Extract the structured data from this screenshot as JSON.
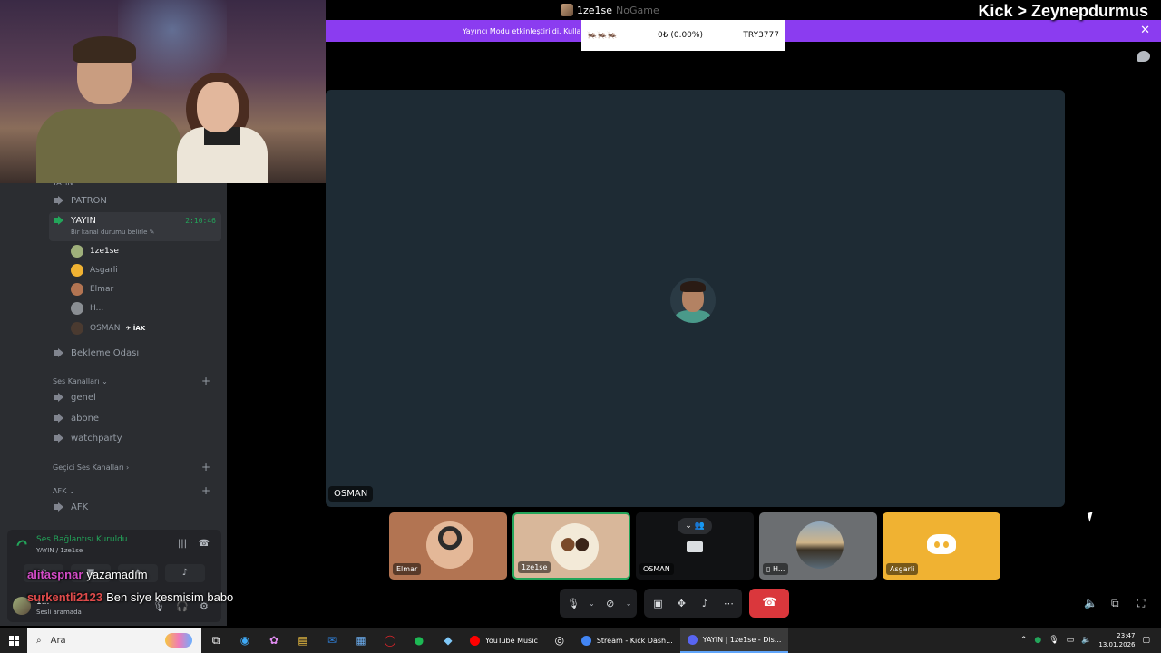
{
  "overlay": {
    "kick_title": "Kick > Zeynepdurmus"
  },
  "window": {
    "title_prefix": "1ze1se",
    "title_ghost": "NoGame"
  },
  "banner": {
    "text": "Yayıncı Modu etkinleştirildi. Kulla"
  },
  "donation": {
    "emotes": "🦗🦗🦗",
    "amount": "0₺ (0.00%)",
    "code": "TRY3777"
  },
  "sidebar": {
    "partial_category": "YAYIN",
    "channels_top": [
      {
        "name": "PATRON"
      }
    ],
    "active_channel": {
      "name": "YAYIN",
      "timer": "2:10:46",
      "status": "Bir kanal durumu belirle ✎"
    },
    "users": [
      {
        "name": "1ze1se",
        "live": true,
        "color": "#9fb07b"
      },
      {
        "name": "Asgarli",
        "live": false,
        "color": "#f0b232"
      },
      {
        "name": "Elmar",
        "live": false,
        "color": "#b27452"
      },
      {
        "name": "H...",
        "live": false,
        "color": "#8a8e93"
      },
      {
        "name": "OSMAN",
        "live": false,
        "color": "#4a3a30",
        "badge": "İAK"
      }
    ],
    "waiting_room": "Bekleme Odası",
    "voice_category": "Ses Kanalları",
    "voice_channels": [
      {
        "name": "genel"
      },
      {
        "name": "abone"
      },
      {
        "name": "watchparty"
      }
    ],
    "temp_category": "Geçici Ses Kanalları",
    "afk_category": "AFK",
    "afk_channel": "AFK"
  },
  "voice_connection": {
    "title": "Ses Bağlantısı Kuruldu",
    "subtitle": "YAYIN / 1ze1se"
  },
  "user_panel": {
    "name": "1...",
    "status": "Sesli aramada"
  },
  "chat_overlay": [
    {
      "user": "alitaspnar",
      "message": "yazamadım",
      "color": "pink"
    },
    {
      "user": "surkentli2123",
      "message": "Ben siye kesmisim babo",
      "color": "red"
    }
  ],
  "stage": {
    "name": "OSMAN"
  },
  "tiles": [
    {
      "name": "Elmar"
    },
    {
      "name": "1ze1se"
    },
    {
      "name": "OSMAN"
    },
    {
      "name": "H..."
    },
    {
      "name": "Asgarli"
    }
  ],
  "taskbar": {
    "search_placeholder": "Ara",
    "apps": [
      {
        "label": "YouTube Music",
        "color": "#ff0000",
        "active": false
      },
      {
        "label": "Stream - Kick Dash...",
        "color": "#4285f4",
        "active": false
      },
      {
        "label": "YAYIN | 1ze1se - Dis...",
        "color": "#5865f2",
        "active": true
      }
    ],
    "time": "23:47",
    "date": "13.01.2026"
  },
  "colors": {
    "accent": "#8b3cf0",
    "voice_green": "#23a55a",
    "end_call": "#da373c"
  }
}
